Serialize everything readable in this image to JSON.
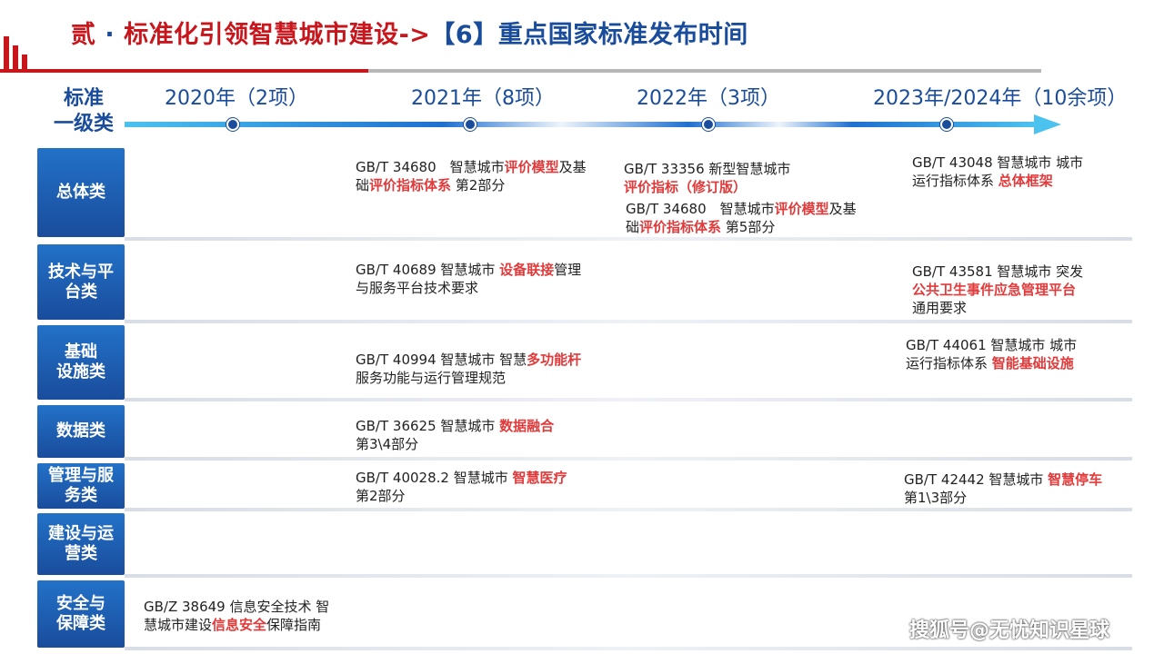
{
  "header": {
    "title_prefix": "贰",
    "title_sep": "·",
    "title_main": "标准化引领智慧城市建设->",
    "title_tail": "【6】重点国家标准发布时间"
  },
  "timeline": {
    "level_label_1": "标准",
    "level_label_2": "一级类",
    "years": [
      {
        "year": "2020年",
        "count": "（2项）"
      },
      {
        "year": "2021年",
        "count": "（8项）"
      },
      {
        "year": "2022年",
        "count": "（3项）"
      },
      {
        "year": "2023年/2024年",
        "count": "（10余项）"
      }
    ]
  },
  "categories": [
    {
      "line1": "总体类",
      "line2": ""
    },
    {
      "line1": "技术与平",
      "line2": "台类"
    },
    {
      "line1": "基础",
      "line2": "设施类"
    },
    {
      "line1": "数据类",
      "line2": ""
    },
    {
      "line1": "管理与服",
      "line2": "务类"
    },
    {
      "line1": "建设与运",
      "line2": "营类"
    },
    {
      "line1": "安全与",
      "line2": "保障类"
    }
  ],
  "standards": {
    "s2021_overall": {
      "a": "GB/T 34680　智慧城市",
      "b": "评价模型",
      "c": "及基",
      "d": "础",
      "e": "评价指标体系",
      "f": " 第2部分"
    },
    "s2022_overall_1": {
      "a": "GB/T 33356  新型智慧城市",
      "b": "评价指标（修订版）"
    },
    "s2022_overall_2": {
      "a": "GB/T 34680　智慧城市",
      "b": "评价模型",
      "c": "及基",
      "d": "础",
      "e": "评价指标体系",
      "f": " 第5部分"
    },
    "s2023_overall": {
      "a": "GB/T 43048  智慧城市 城市",
      "b": "运行指标体系 ",
      "c": "总体框架"
    },
    "s2021_tech": {
      "a": "GB/T 40689 智慧城市 ",
      "b": "设备联接",
      "c": "管理",
      "d": "与服务平台技术要求"
    },
    "s2023_tech": {
      "a": "GB/T 43581  智慧城市 突发",
      "b": "公共卫生事件应急管理平台",
      "c": "通用要求"
    },
    "s2021_infra": {
      "a": "GB/T 40994 智慧城市 智慧",
      "b": "多功能杆",
      "c": "服务功能与运行管理规范"
    },
    "s2023_infra": {
      "a": "GB/T 44061   智慧城市 城市",
      "b": "运行指标体系 ",
      "c": "智能基础设施"
    },
    "s2021_data": {
      "a": "GB/T 36625 智慧城市 ",
      "b": "数据融合",
      "c": "第3\\4部分"
    },
    "s2021_mgmt": {
      "a": "GB/T 40028.2 智慧城市 ",
      "b": "智慧医疗",
      "c": "第2部分"
    },
    "s2023_mgmt": {
      "a": "GB/T 42442 智慧城市 ",
      "b": "智慧停车",
      "c": "第1\\3部分"
    },
    "s2020_security": {
      "a": "GB/Z 38649 信息安全技术 智",
      "b": "慧城市建设",
      "c": "信息安全",
      "d": "保障指南"
    }
  },
  "watermark": "搜狐号@无忧知识星球",
  "colors": {
    "brand_red": "#c8161d",
    "brand_blue": "#1a4c9c",
    "highlight": "#e23a3a"
  }
}
